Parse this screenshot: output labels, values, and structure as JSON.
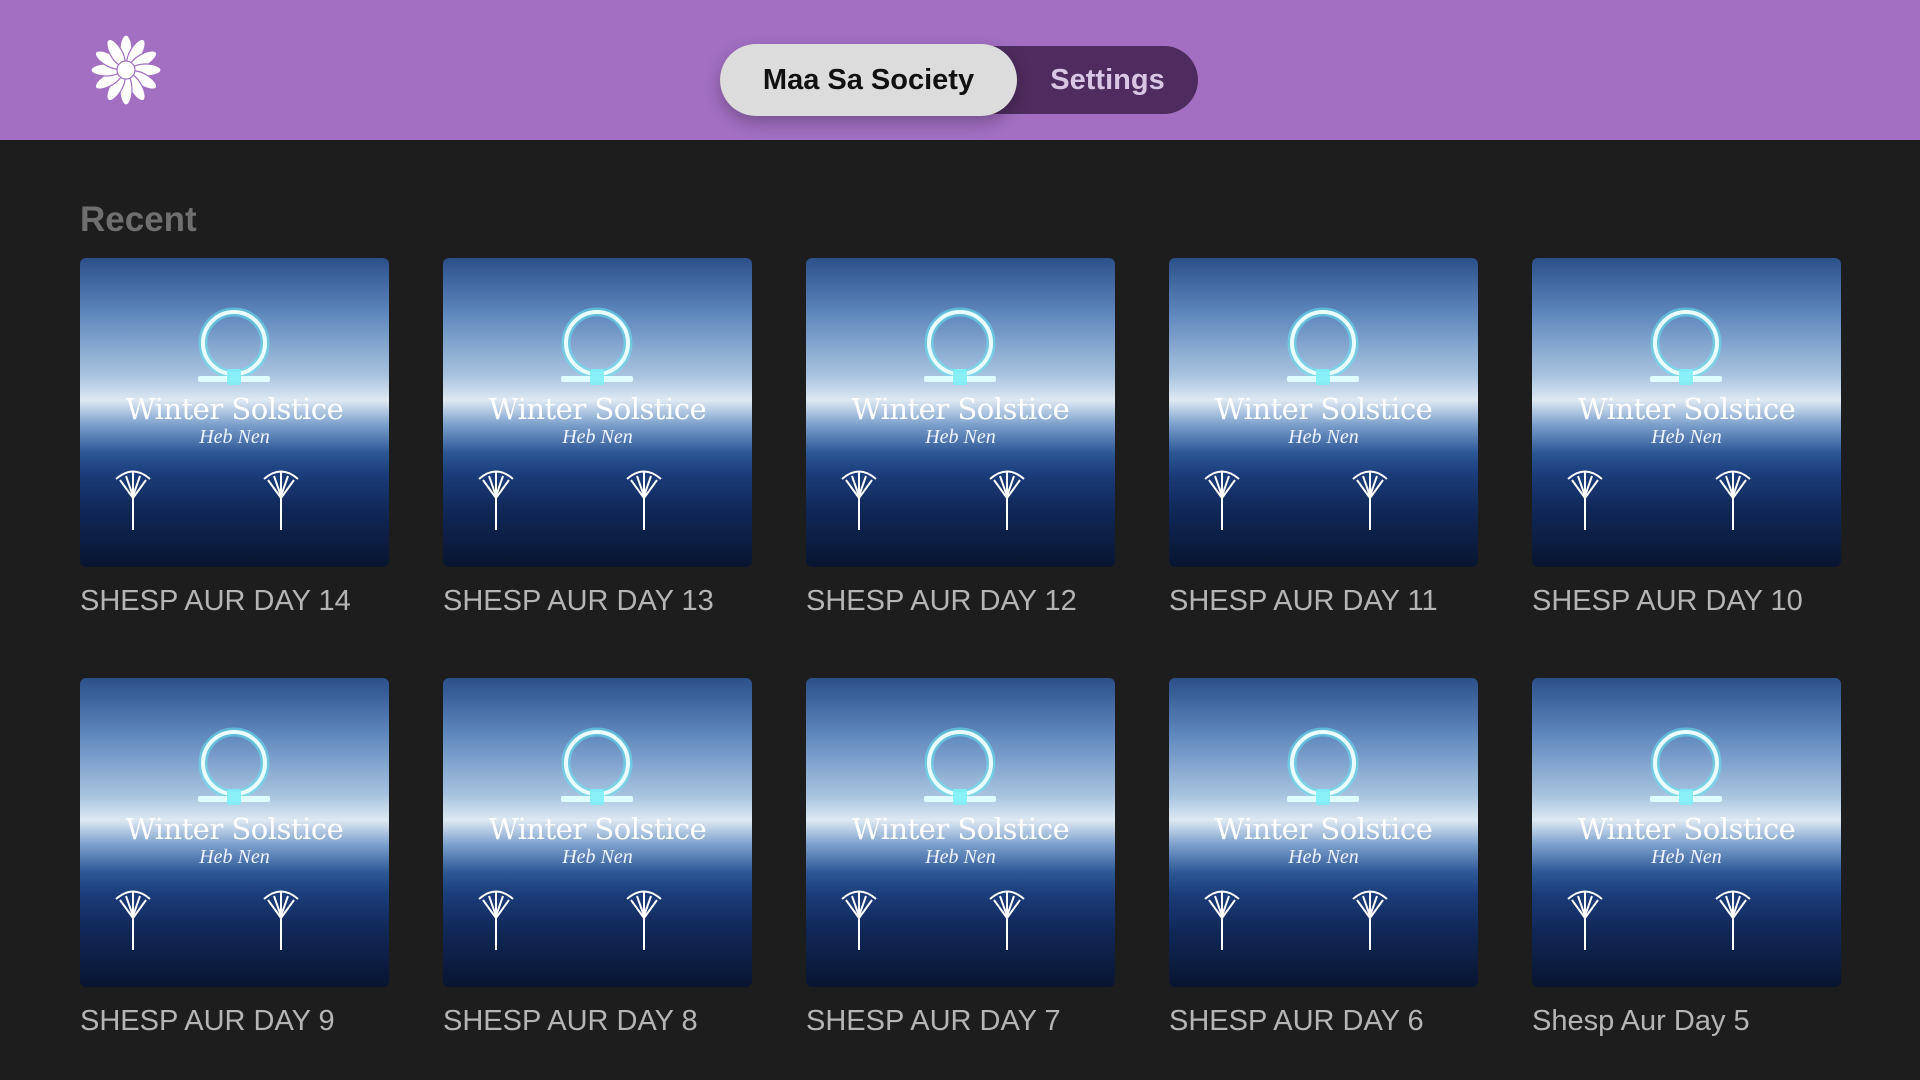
{
  "app": {
    "logo_icon": "white-lotus-flower-icon",
    "header_color": "#a26fc2"
  },
  "tabs": [
    {
      "label": "Maa Sa Society",
      "selected": true
    },
    {
      "label": "Settings",
      "selected": false
    }
  ],
  "recent": {
    "title": "Recent",
    "items": [
      {
        "label": "SHESP AUR DAY 14",
        "art_title": "Winter Solstice",
        "art_subtitle": "Heb Nen"
      },
      {
        "label": "SHESP AUR DAY 13",
        "art_title": "Winter Solstice",
        "art_subtitle": "Heb Nen"
      },
      {
        "label": "SHESP AUR DAY 12",
        "art_title": "Winter Solstice",
        "art_subtitle": "Heb Nen"
      },
      {
        "label": "SHESP AUR DAY 11",
        "art_title": "Winter Solstice",
        "art_subtitle": "Heb Nen"
      },
      {
        "label": "SHESP AUR DAY 10",
        "art_title": "Winter Solstice",
        "art_subtitle": "Heb Nen"
      },
      {
        "label": "SHESP AUR DAY 9",
        "art_title": "Winter Solstice",
        "art_subtitle": "Heb Nen"
      },
      {
        "label": "SHESP AUR DAY 8",
        "art_title": "Winter Solstice",
        "art_subtitle": "Heb Nen"
      },
      {
        "label": "SHESP AUR DAY 7",
        "art_title": "Winter Solstice",
        "art_subtitle": "Heb Nen"
      },
      {
        "label": "SHESP AUR DAY 6",
        "art_title": "Winter Solstice",
        "art_subtitle": "Heb Nen"
      },
      {
        "label": "Shesp Aur Day 5",
        "art_title": "Winter Solstice",
        "art_subtitle": "Heb Nen"
      }
    ]
  }
}
